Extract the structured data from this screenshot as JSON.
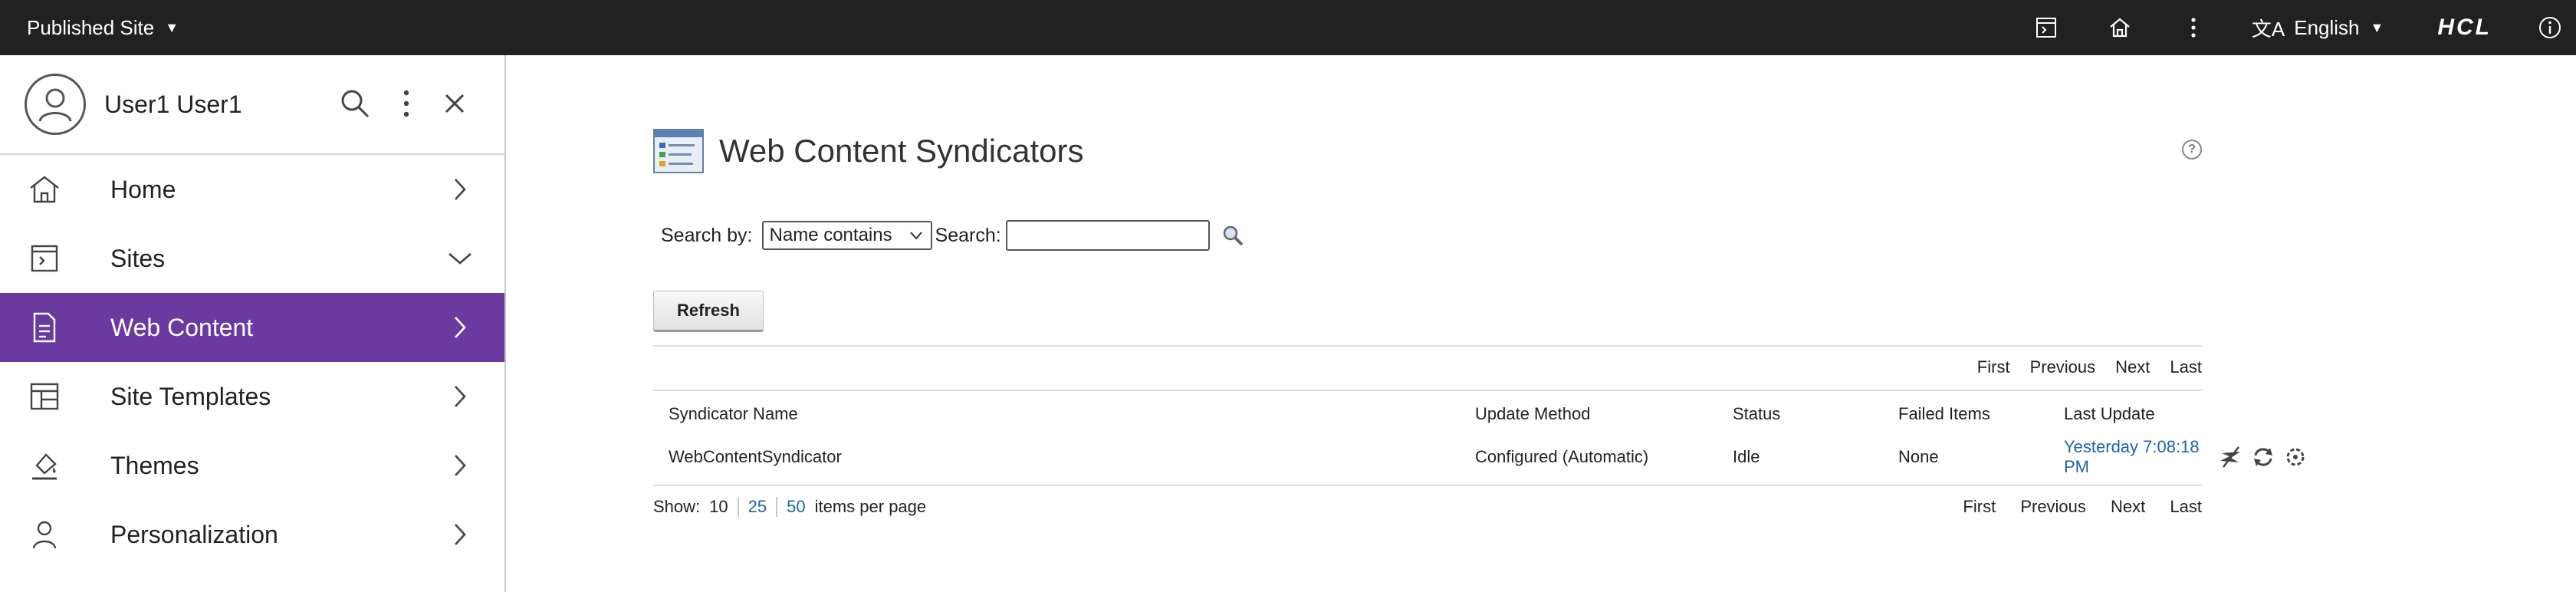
{
  "topbar": {
    "site_selector": "Published Site",
    "language": "English",
    "logo_text": "HCL",
    "icons": [
      "toolbar-icon",
      "home-icon",
      "more-vertical-icon",
      "translate-icon",
      "info-icon"
    ],
    "background": "#212121"
  },
  "sidebar": {
    "user_name": "User1 User1",
    "items": [
      {
        "label": "Home",
        "icon": "home-icon",
        "chevron": "right"
      },
      {
        "label": "Sites",
        "icon": "sites-icon",
        "chevron": "down"
      },
      {
        "label": "Web Content",
        "icon": "document-icon",
        "chevron": "right",
        "active": true
      },
      {
        "label": "Site Templates",
        "icon": "template-icon",
        "chevron": "right"
      },
      {
        "label": "Themes",
        "icon": "paint-icon",
        "chevron": "right"
      },
      {
        "label": "Personalization",
        "icon": "person-icon",
        "chevron": "right"
      }
    ],
    "active_color": "#6b3aa0"
  },
  "main": {
    "title": "Web Content Syndicators",
    "search": {
      "search_by_label": "Search by:",
      "search_by_value": "Name contains",
      "search_label": "Search:",
      "search_value": ""
    },
    "refresh_label": "Refresh",
    "pager": {
      "first": "First",
      "previous": "Previous",
      "next": "Next",
      "last": "Last"
    },
    "table": {
      "headers": [
        "Syndicator Name",
        "Update Method",
        "Status",
        "Failed Items",
        "Last Update"
      ],
      "rows": [
        {
          "name": "WebContentSyndicator",
          "method": "Configured (Automatic)",
          "status": "Idle",
          "failed": "None",
          "last_update": "Yesterday 7:08:18 PM"
        }
      ]
    },
    "page_size": {
      "label": "Show:",
      "current": "10",
      "options": [
        "25",
        "50"
      ],
      "suffix": "items per page"
    },
    "link_color": "#1f62a9"
  }
}
